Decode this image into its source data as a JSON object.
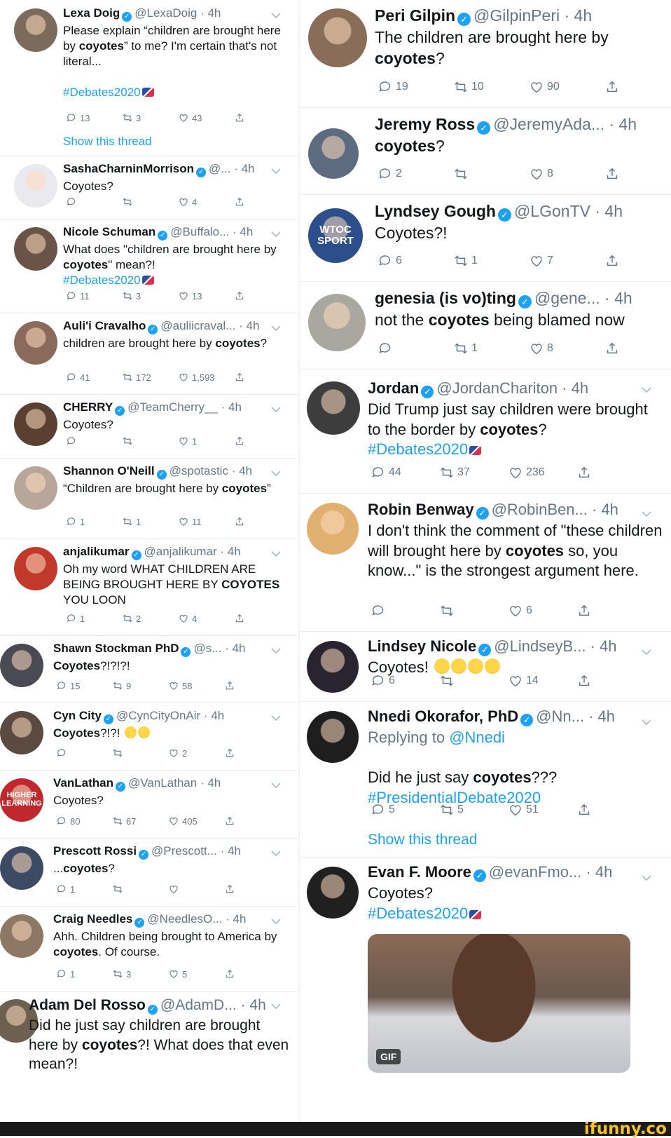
{
  "watermark": "ifunny.co",
  "left": [
    {
      "name": "Lexa Doig",
      "handle": "@LexaDoig",
      "time": "4h",
      "text": "Please explain “children are brought here by <b>coyotes</b>” to me?  I'm certain that's not literal...<br><br><span class=\"link\">#Debates2020</span><span class=\"flag\"></span>",
      "replies": "13",
      "retweets": "3",
      "likes": "43",
      "thread": "Show this thread",
      "chevron": true,
      "avatar_color": "#7c6a5c"
    },
    {
      "name": "SashaCharninMorrison",
      "handle": "@...",
      "time": "4h",
      "text": "Coyotes?",
      "replies": "",
      "retweets": "",
      "likes": "4",
      "chevron": true,
      "avatar_color": "#e9e9ef"
    },
    {
      "name": "Nicole Schuman",
      "handle": "@Buffalo...",
      "time": "4h",
      "text": "What does \"children are brought here by <b>coyotes</b>\" mean?!<br><span class=\"link\">#Debates2020</span><span class=\"flag\"></span>",
      "replies": "11",
      "retweets": "3",
      "likes": "13",
      "chevron": true,
      "avatar_color": "#6b5447"
    },
    {
      "name": "Auli'i Cravalho",
      "handle": "@auliicraval...",
      "time": "4h",
      "text": "children are brought here by <b>coyotes</b>?",
      "replies": "41",
      "retweets": "172",
      "likes": "1,593",
      "chevron": true,
      "avatar_color": "#8a6a5a"
    },
    {
      "name": "CHERRY",
      "handle": "@TeamCherry__",
      "time": "4h",
      "text": "Coyotes?",
      "replies": "",
      "retweets": "",
      "likes": "1",
      "chevron": true,
      "avatar_color": "#5a4030"
    },
    {
      "name": "Shannon O'Neill",
      "handle": "@spotastic",
      "time": "4h",
      "text": "“Children are brought here by <b>coyotes</b>”",
      "replies": "1",
      "retweets": "1",
      "likes": "11",
      "chevron": true,
      "avatar_color": "#b8a69a"
    },
    {
      "name": "anjalikumar",
      "handle": "@anjalikumar",
      "time": "4h",
      "text": "Oh my word WHAT CHILDREN ARE BEING BROUGHT HERE BY <b>COYOTES</b> YOU LOON",
      "replies": "1",
      "retweets": "2",
      "likes": "4",
      "chevron": true,
      "avatar_color": "#c0392b"
    },
    {
      "name": "Shawn Stockman PhD",
      "handle": "@s...",
      "time": "4h",
      "text": "<b>Coyotes</b>?!?!?!",
      "replies": "15",
      "retweets": "9",
      "likes": "58",
      "chevron": true,
      "avatar_color": "#4a4a55"
    },
    {
      "name": "Cyn City",
      "handle": "@CynCityOnAir",
      "time": "4h",
      "text": "<b>Coyotes</b>?!?! <span class=\"emoji\"></span><span class=\"emoji\"></span>",
      "replies": "",
      "retweets": "",
      "likes": "2",
      "chevron": true,
      "avatar_color": "#5b4a40"
    },
    {
      "name": "VanLathan",
      "handle": "@VanLathan",
      "time": "4h",
      "text": "Coyotes?",
      "replies": "80",
      "retweets": "67",
      "likes": "405",
      "chevron": true,
      "avatar_color": "#c0282d",
      "avatar_text": "HIGHER LEARNING"
    },
    {
      "name": "Prescott Rossi",
      "handle": "@Prescott...",
      "time": "4h",
      "text": "...<b>coyotes</b>?",
      "replies": "1",
      "retweets": "",
      "likes": "",
      "chevron": true,
      "avatar_color": "#3d4a63"
    },
    {
      "name": "Craig Needles",
      "handle": "@NeedlesO...",
      "time": "4h",
      "text": "Ahh. Children being brought to America by <b>coyotes</b>. Of course.",
      "replies": "1",
      "retweets": "3",
      "likes": "5",
      "chevron": true,
      "avatar_color": "#8d7866"
    },
    {
      "name": "Adam Del Rosso",
      "handle": "@AdamD...",
      "time": "4h",
      "text": "Did he just say children are brought here by <b>coyotes</b>?! What does that even mean?!",
      "chevron": true,
      "avatar_color": "#6d6050"
    }
  ],
  "right": [
    {
      "name": "Peri Gilpin",
      "handle": "@GilpinPeri",
      "time": "4h",
      "text": "The children are brought here by <b>coyotes</b>?",
      "replies": "19",
      "retweets": "10",
      "likes": "90",
      "chevron": false,
      "avatar_color": "#8a6d58"
    },
    {
      "name": "Jeremy Ross",
      "handle": "@JeremyAda...",
      "time": "4h",
      "text": "<b>coyotes</b>?",
      "replies": "2",
      "retweets": "",
      "likes": "8",
      "chevron": false,
      "avatar_color": "#5c6b80"
    },
    {
      "name": "Lyndsey Gough",
      "handle": "@LGonTV",
      "time": "4h",
      "text": "Coyotes?!",
      "replies": "6",
      "retweets": "1",
      "likes": "7",
      "chevron": false,
      "avatar_color": "#2c4f8c",
      "avatar_text": "WTOC SPORT"
    },
    {
      "name": "genesia (is vo)ting",
      "handle": "@gene...",
      "time": "4h",
      "text": "not the <b>coyotes</b> being blamed now",
      "replies": "",
      "retweets": "1",
      "likes": "8",
      "chevron": false,
      "avatar_color": "#a8a8a0"
    },
    {
      "name": "Jordan",
      "handle": "@JordanChariton",
      "time": "4h",
      "text": "Did Trump just say children were brought to the border by <b>coyotes</b>?<br><span class=\"link\">#Debates2020</span><span class=\"flag\"></span>",
      "replies": "44",
      "retweets": "37",
      "likes": "236",
      "chevron": true,
      "avatar_color": "#3d3d3d"
    },
    {
      "name": "Robin Benway",
      "handle": "@RobinBen...",
      "time": "4h",
      "text": "I don't think the comment of \"these children will brought here by <b>coyotes</b> so, you know...\" is the strongest argument here.",
      "replies": "",
      "retweets": "",
      "likes": "6",
      "chevron": true,
      "avatar_color": "#e0b070"
    },
    {
      "name": "Lindsey Nicole",
      "handle": "@LindseyB...",
      "time": "4h",
      "text": "Coyotes! <span class=\"emoji\"></span><span class=\"emoji\"></span><span class=\"emoji\"></span><span class=\"emoji\"></span>",
      "replies": "6",
      "retweets": "",
      "likes": "14",
      "chevron": true,
      "avatar_color": "#2a2430"
    },
    {
      "name": "Nnedi Okorafor, PhD",
      "handle": "@Nn...",
      "time": "4h",
      "text": "<span class=\"handle\">Replying to </span><span class=\"link\">@Nnedi</span><br><br>Did he just say <b>coyotes</b>???<br><span class=\"link\">#PresidentialDebate2020</span>",
      "replies": "5",
      "retweets": "5",
      "likes": "51",
      "thread": "Show this thread",
      "chevron": true,
      "avatar_color": "#1e1e1e"
    },
    {
      "name": "Evan F. Moore",
      "handle": "@evanFmo...",
      "time": "4h",
      "text": "Coyotes?<br><span class=\"link\">#Debates2020</span><span class=\"flag\"></span>",
      "gif": "GIF",
      "chevron": true,
      "avatar_color": "#202020"
    }
  ]
}
